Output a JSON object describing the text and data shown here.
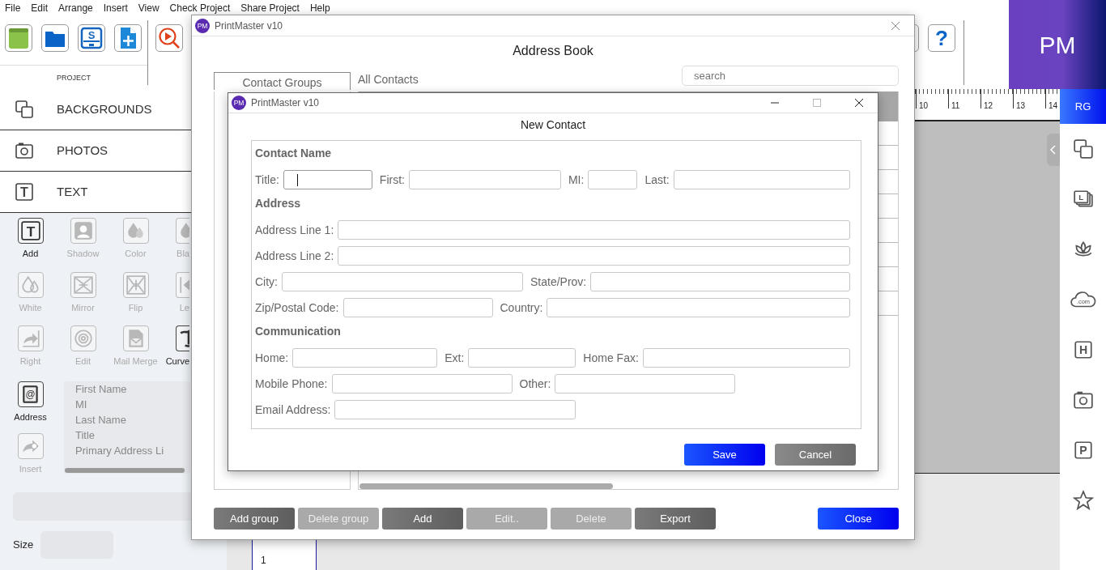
{
  "menu": [
    {
      "label": "File"
    },
    {
      "label": "Edit"
    },
    {
      "label": "Arrange"
    },
    {
      "label": "Insert"
    },
    {
      "label": "View"
    },
    {
      "label": "Check Project"
    },
    {
      "label": "Share Project"
    },
    {
      "label": "Help"
    }
  ],
  "toolbar": {
    "project_buttons": [
      {
        "kind": "notebook"
      },
      {
        "kind": "folder"
      },
      {
        "kind": "save",
        "glyph": "S"
      },
      {
        "kind": "newdoc"
      }
    ],
    "project_label": "PROJECT",
    "preview_button": {
      "kind": "preview"
    },
    "help_button": "?",
    "logo": "PM"
  },
  "left_nav": [
    {
      "label": "BACKGROUNDS",
      "kind": "layers"
    },
    {
      "label": "PHOTOS",
      "kind": "camera"
    },
    {
      "label": "TEXT",
      "kind": "letter",
      "glyph": "T"
    }
  ],
  "text_tools": [
    {
      "label": "Add",
      "kind": "letter",
      "glyph": "T",
      "disabled": false
    },
    {
      "label": "Shadow",
      "kind": "person",
      "disabled": true
    },
    {
      "label": "Color",
      "kind": "drops",
      "disabled": true
    },
    {
      "label": "Bla",
      "kind": "drops",
      "disabled": true
    },
    {
      "label": "White",
      "kind": "dropsoutline",
      "disabled": true
    },
    {
      "label": "Mirror",
      "kind": "mirror",
      "disabled": true
    },
    {
      "label": "Flip",
      "kind": "flip",
      "disabled": true
    },
    {
      "label": "Le",
      "kind": "left",
      "disabled": true
    },
    {
      "label": "Right",
      "kind": "right",
      "disabled": true
    },
    {
      "label": "Edit",
      "kind": "gear",
      "disabled": true
    },
    {
      "label": "Mail Merge",
      "kind": "mail",
      "disabled": true
    },
    {
      "label": "Curve",
      "kind": "curve",
      "disabled": false
    }
  ],
  "address_tools": [
    {
      "label": "Address",
      "kind": "book",
      "glyph": "@",
      "disabled": false
    },
    {
      "label": "Insert",
      "kind": "share",
      "disabled": true
    }
  ],
  "address_fields": [
    "First Name",
    "MI",
    "Last Name",
    "Title",
    "Primary Address Li"
  ],
  "size_label": "Size",
  "ruler": [
    "10",
    "11",
    "12",
    "13",
    "14"
  ],
  "page_thumb": "1",
  "right_sidebar": {
    "top_button": "RG",
    "icons": [
      {
        "kind": "layers"
      },
      {
        "kind": "stack",
        "glyph": "L"
      },
      {
        "kind": "lotus"
      },
      {
        "kind": "cloud",
        "glyph": ".com"
      },
      {
        "kind": "boxed",
        "glyph": "H"
      },
      {
        "kind": "camera"
      },
      {
        "kind": "boxed",
        "glyph": "P"
      },
      {
        "kind": "star"
      }
    ]
  },
  "address_book": {
    "app_icon": "PM",
    "window_title": "PrintMaster v10",
    "heading": "Address Book",
    "groups_tab": "Contact Groups",
    "contacts_label": "All Contacts",
    "search": {
      "placeholder": "search"
    },
    "buttons": [
      {
        "label": "Add group",
        "kind": "normal",
        "disabled": false
      },
      {
        "label": "Delete group",
        "kind": "normal",
        "disabled": true
      },
      {
        "label": "Add",
        "kind": "normal",
        "disabled": false
      },
      {
        "label": "Edit..",
        "kind": "normal",
        "disabled": true
      },
      {
        "label": "Delete",
        "kind": "normal",
        "disabled": true
      },
      {
        "label": "Export",
        "kind": "normal",
        "disabled": false
      },
      {
        "label": "Close",
        "kind": "primary",
        "disabled": false
      }
    ]
  },
  "new_contact": {
    "app_icon": "PM",
    "window_title": "PrintMaster v10",
    "heading": "New Contact",
    "sections": [
      {
        "title": "Contact Name",
        "rows": [
          [
            {
              "label": "Title:",
              "focused": true
            },
            {
              "label": "First:",
              "focused": false
            },
            {
              "label": "MI:",
              "focused": false
            },
            {
              "label": "Last:",
              "focused": false
            }
          ]
        ]
      },
      {
        "title": "Address",
        "rows": [
          [
            {
              "label": "Address Line 1:",
              "focused": false
            }
          ],
          [
            {
              "label": "Address Line 2:",
              "focused": false
            }
          ],
          [
            {
              "label": "City:",
              "focused": false
            },
            {
              "label": "State/Prov:",
              "focused": false
            }
          ],
          [
            {
              "label": "Zip/Postal Code:",
              "focused": false
            },
            {
              "label": "Country:",
              "focused": false
            }
          ]
        ]
      },
      {
        "title": "Communication",
        "rows": [
          [
            {
              "label": "Home:",
              "focused": false
            },
            {
              "label": "Ext:",
              "focused": false
            },
            {
              "label": "Home Fax:",
              "focused": false
            }
          ],
          [
            {
              "label": "Mobile Phone:",
              "focused": false
            },
            {
              "label": "Other:",
              "focused": false
            }
          ],
          [
            {
              "label": "Email Address:",
              "focused": false
            }
          ]
        ]
      }
    ],
    "buttons": [
      {
        "label": "Save",
        "kind": "primary"
      },
      {
        "label": "Cancel",
        "kind": "secondary"
      }
    ]
  }
}
